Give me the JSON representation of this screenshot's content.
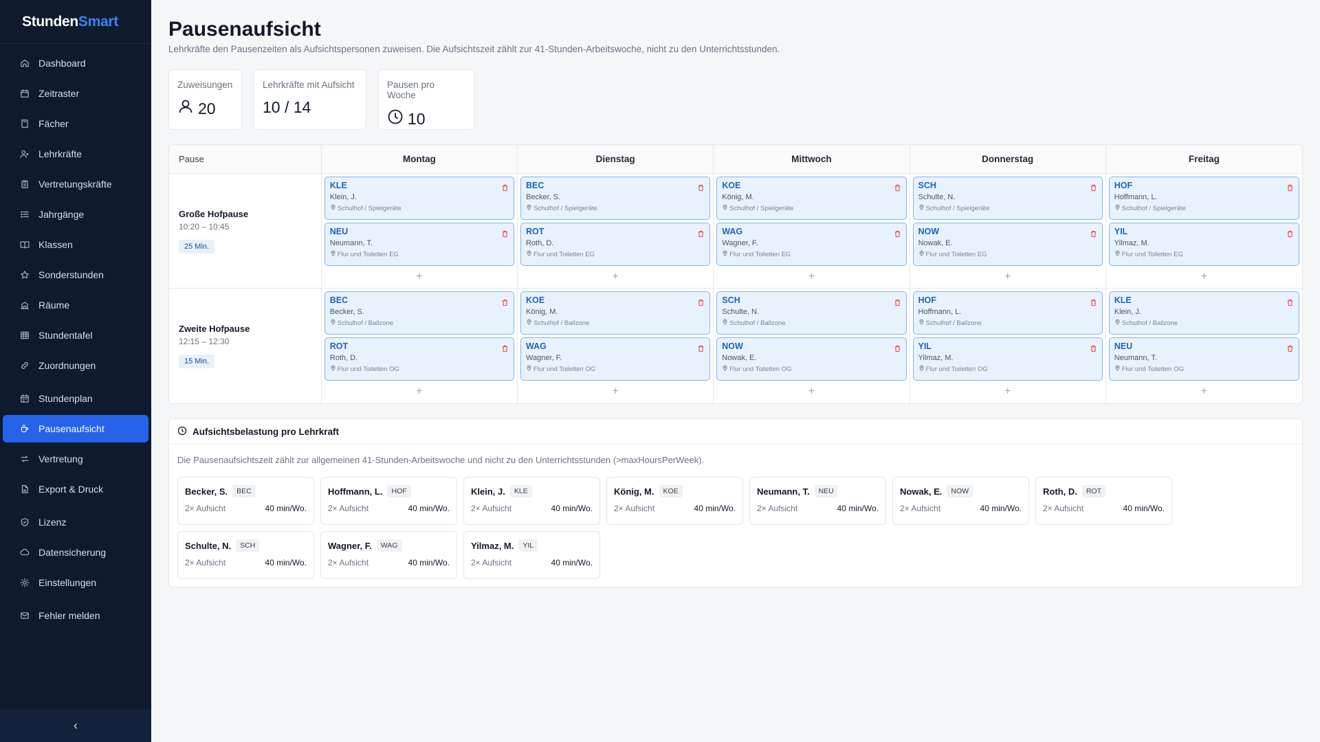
{
  "brand": {
    "part1": "Stunden",
    "part2": "Smart"
  },
  "sidebar": {
    "items": [
      {
        "label": "Dashboard",
        "icon": "home-icon"
      },
      {
        "label": "Zeitraster",
        "icon": "calendar-icon"
      },
      {
        "label": "Fächer",
        "icon": "book-icon"
      },
      {
        "label": "Lehrkräfte",
        "icon": "users-icon"
      },
      {
        "label": "Vertretungskräfte",
        "icon": "clipboard-icon"
      },
      {
        "label": "Jahrgänge",
        "icon": "list-icon"
      },
      {
        "label": "Klassen",
        "icon": "open-book-icon"
      },
      {
        "label": "Sonderstunden",
        "icon": "star-icon"
      },
      {
        "label": "Räume",
        "icon": "building-icon"
      },
      {
        "label": "Stundentafel",
        "icon": "table-icon"
      },
      {
        "label": "Zuordnungen",
        "icon": "link-icon"
      },
      {
        "label": "Stundenplan",
        "icon": "calendar-grid-icon"
      },
      {
        "label": "Pausenaufsicht",
        "icon": "coffee-icon"
      },
      {
        "label": "Vertretung",
        "icon": "swap-icon"
      },
      {
        "label": "Export & Druck",
        "icon": "file-icon"
      },
      {
        "label": "Lizenz",
        "icon": "shield-icon"
      },
      {
        "label": "Datensicherung",
        "icon": "cloud-icon"
      },
      {
        "label": "Einstellungen",
        "icon": "gear-icon"
      },
      {
        "label": "Fehler melden",
        "icon": "mail-icon"
      }
    ],
    "active_index": 12,
    "collapse_glyph": "‹"
  },
  "page": {
    "title": "Pausenaufsicht",
    "subtitle": "Lehrkräfte den Pausenzeiten als Aufsichtspersonen zuweisen. Die Aufsichtszeit zählt zur 41-Stunden-Arbeitswoche, nicht zu den Unterrichtsstunden."
  },
  "stats": [
    {
      "label": "Zuweisungen",
      "value": "20",
      "icon": "person-icon"
    },
    {
      "label": "Lehrkräfte mit Aufsicht",
      "value": "10 / 14",
      "icon": ""
    },
    {
      "label": "Pausen pro Woche",
      "value": "10",
      "icon": "clock-icon"
    }
  ],
  "grid": {
    "col0": "Pause",
    "days": [
      "Montag",
      "Dienstag",
      "Mittwoch",
      "Donnerstag",
      "Freitag"
    ],
    "add_glyph": "+",
    "breaks": [
      {
        "name": "Große Hofpause",
        "time": "10:20 – 10:45",
        "duration": "25 Min.",
        "cells": [
          [
            {
              "code": "KLE",
              "name": "Klein, J.",
              "loc": "Schulhof / Spielgeräte"
            },
            {
              "code": "NEU",
              "name": "Neumann, T.",
              "loc": "Flur und Toiletten EG"
            }
          ],
          [
            {
              "code": "BEC",
              "name": "Becker, S.",
              "loc": "Schulhof / Spielgeräte"
            },
            {
              "code": "ROT",
              "name": "Roth, D.",
              "loc": "Flur und Toiletten EG"
            }
          ],
          [
            {
              "code": "KOE",
              "name": "König, M.",
              "loc": "Schulhof / Spielgeräte"
            },
            {
              "code": "WAG",
              "name": "Wagner, F.",
              "loc": "Flur und Toiletten EG"
            }
          ],
          [
            {
              "code": "SCH",
              "name": "Schulte, N.",
              "loc": "Schulhof / Spielgeräte"
            },
            {
              "code": "NOW",
              "name": "Nowak, E.",
              "loc": "Flur und Toiletten EG"
            }
          ],
          [
            {
              "code": "HOF",
              "name": "Hoffmann, L.",
              "loc": "Schulhof / Spielgeräte"
            },
            {
              "code": "YIL",
              "name": "Yilmaz, M.",
              "loc": "Flur und Toiletten EG"
            }
          ]
        ]
      },
      {
        "name": "Zweite Hofpause",
        "time": "12:15 – 12:30",
        "duration": "15 Min.",
        "cells": [
          [
            {
              "code": "BEC",
              "name": "Becker, S.",
              "loc": "Schulhof / Ballzone"
            },
            {
              "code": "ROT",
              "name": "Roth, D.",
              "loc": "Flur und Toiletten OG"
            }
          ],
          [
            {
              "code": "KOE",
              "name": "König, M.",
              "loc": "Schulhof / Ballzone"
            },
            {
              "code": "WAG",
              "name": "Wagner, F.",
              "loc": "Flur und Toiletten OG"
            }
          ],
          [
            {
              "code": "SCH",
              "name": "Schulte, N.",
              "loc": "Schulhof / Ballzone"
            },
            {
              "code": "NOW",
              "name": "Nowak, E.",
              "loc": "Flur und Toiletten OG"
            }
          ],
          [
            {
              "code": "HOF",
              "name": "Hoffmann, L.",
              "loc": "Schulhof / Ballzone"
            },
            {
              "code": "YIL",
              "name": "Yilmaz, M.",
              "loc": "Flur und Toiletten OG"
            }
          ],
          [
            {
              "code": "KLE",
              "name": "Klein, J.",
              "loc": "Schulhof / Ballzone"
            },
            {
              "code": "NEU",
              "name": "Neumann, T.",
              "loc": "Flur und Toiletten OG"
            }
          ]
        ]
      }
    ]
  },
  "load": {
    "title": "Aufsichtsbelastung pro Lehrkraft",
    "note": "Die Pausenaufsichtszeit zählt zur allgemeinen 41-Stunden-Arbeitswoche und nicht zu den Unterrichtsstunden (>maxHoursPerWeek).",
    "teachers": [
      {
        "name": "Becker, S.",
        "abbr": "BEC",
        "count": "2× Aufsicht",
        "minutes": "40 min/Wo."
      },
      {
        "name": "Hoffmann, L.",
        "abbr": "HOF",
        "count": "2× Aufsicht",
        "minutes": "40 min/Wo."
      },
      {
        "name": "Klein, J.",
        "abbr": "KLE",
        "count": "2× Aufsicht",
        "minutes": "40 min/Wo."
      },
      {
        "name": "König, M.",
        "abbr": "KOE",
        "count": "2× Aufsicht",
        "minutes": "40 min/Wo."
      },
      {
        "name": "Neumann, T.",
        "abbr": "NEU",
        "count": "2× Aufsicht",
        "minutes": "40 min/Wo."
      },
      {
        "name": "Nowak, E.",
        "abbr": "NOW",
        "count": "2× Aufsicht",
        "minutes": "40 min/Wo."
      },
      {
        "name": "Roth, D.",
        "abbr": "ROT",
        "count": "2× Aufsicht",
        "minutes": "40 min/Wo."
      },
      {
        "name": "Schulte, N.",
        "abbr": "SCH",
        "count": "2× Aufsicht",
        "minutes": "40 min/Wo."
      },
      {
        "name": "Wagner, F.",
        "abbr": "WAG",
        "count": "2× Aufsicht",
        "minutes": "40 min/Wo."
      },
      {
        "name": "Yilmaz, M.",
        "abbr": "YIL",
        "count": "2× Aufsicht",
        "minutes": "40 min/Wo."
      }
    ]
  },
  "colors": {
    "sidebar_bg": "#0f1b2d",
    "accent": "#2563eb",
    "card_bg": "#e8f2fc",
    "card_border": "#7fb5ec",
    "delete": "#ef4444"
  }
}
